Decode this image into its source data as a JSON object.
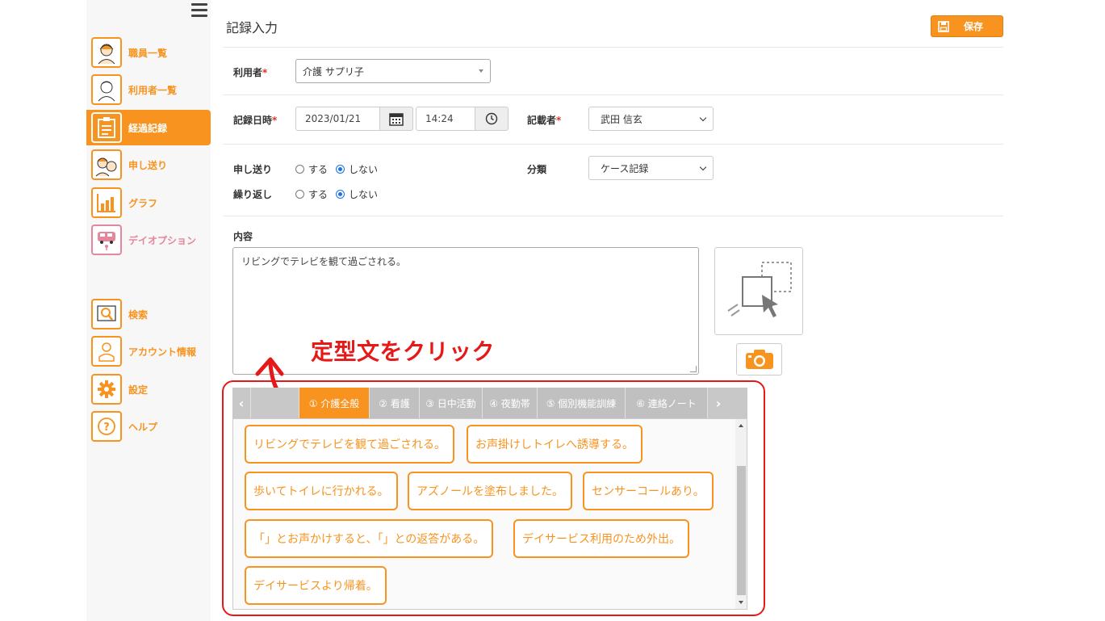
{
  "colors": {
    "accent": "#f7931e",
    "pink": "#e5869a",
    "annotation_red": "#e61919",
    "radio_blue": "#1a73e8"
  },
  "sidebar": {
    "items": [
      {
        "label": "職員一覧",
        "icon": "staff-icon"
      },
      {
        "label": "利用者一覧",
        "icon": "resident-icon"
      },
      {
        "label": "経過記録",
        "icon": "clipboard-icon",
        "active": true
      },
      {
        "label": "申し送り",
        "icon": "handover-icon"
      },
      {
        "label": "グラフ",
        "icon": "graph-icon"
      },
      {
        "label": "デイオプション",
        "icon": "bus-icon"
      },
      {
        "label": "検索",
        "icon": "search-icon"
      },
      {
        "label": "アカウント情報",
        "icon": "account-icon"
      },
      {
        "label": "設定",
        "icon": "gear-icon"
      },
      {
        "label": "ヘルプ",
        "icon": "help-icon"
      }
    ]
  },
  "header": {
    "title": "記録入力",
    "save_label": "保存"
  },
  "form": {
    "user_label": "利用者",
    "required_mark": "*",
    "user_value": "介護 サプリ子",
    "datetime_label": "記録日時",
    "date_value": "2023/01/21",
    "time_value": "14:24",
    "recorder_label": "記載者",
    "recorder_value": "武田 信玄",
    "handover_label": "申し送り",
    "repeat_label": "繰り返し",
    "radio_yes": "する",
    "radio_no": "しない",
    "handover_selected": "しない",
    "repeat_selected": "しない",
    "category_label": "分類",
    "category_value": "ケース記録",
    "content_label": "内容",
    "content_value": "リビングでテレビを観て過ごされる。"
  },
  "annotation": {
    "text": "定型文をクリック"
  },
  "templates": {
    "tabs": [
      {
        "label": "① 介護全般",
        "active": true
      },
      {
        "label": "② 看護"
      },
      {
        "label": "③ 日中活動"
      },
      {
        "label": "④ 夜勤帯"
      },
      {
        "label": "⑤ 個別機能訓練"
      },
      {
        "label": "⑥ 連絡ノート"
      }
    ],
    "phrases": [
      "リビングでテレビを観て過ごされる。",
      "お声掛けしトイレへ誘導する。",
      "歩いてトイレに行かれる。",
      "アズノールを塗布しました。",
      "センサーコールあり。",
      "「」とお声かけすると、「」との返答がある。",
      "デイサービス利用のため外出。",
      "デイサービスより帰着。"
    ]
  }
}
